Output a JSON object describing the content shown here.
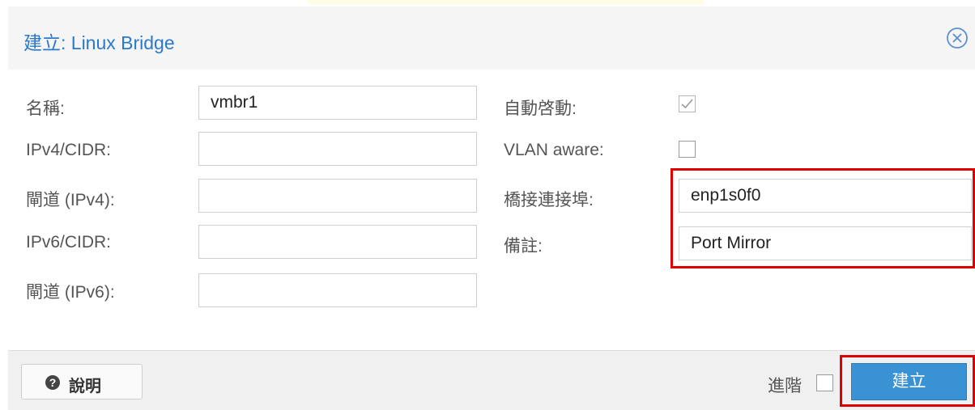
{
  "dialog": {
    "title": "建立: Linux Bridge"
  },
  "form": {
    "left": [
      {
        "label": "名稱:",
        "value": "vmbr1"
      },
      {
        "label": "IPv4/CIDR:",
        "value": ""
      },
      {
        "label": "閘道 (IPv4):",
        "value": ""
      },
      {
        "label": "IPv6/CIDR:",
        "value": ""
      },
      {
        "label": "閘道 (IPv6):",
        "value": ""
      }
    ],
    "right": {
      "autostart": {
        "label": "自動啓動:",
        "checked": true
      },
      "vlan_aware": {
        "label": "VLAN aware:",
        "checked": false
      },
      "bridge_ports": {
        "label": "橋接連接埠:",
        "value": "enp1s0f0"
      },
      "comment": {
        "label": "備註:",
        "value": "Port Mirror"
      }
    }
  },
  "footer": {
    "help_label": "說明",
    "advanced_label": "進階",
    "advanced_checked": false,
    "create_label": "建立"
  },
  "icons": {
    "close": "close-icon",
    "help": "help-icon",
    "checkmark": "checkmark-icon"
  },
  "colors": {
    "title": "#2b79c9",
    "primary_button": "#3892d4",
    "highlight": "#e00000"
  }
}
